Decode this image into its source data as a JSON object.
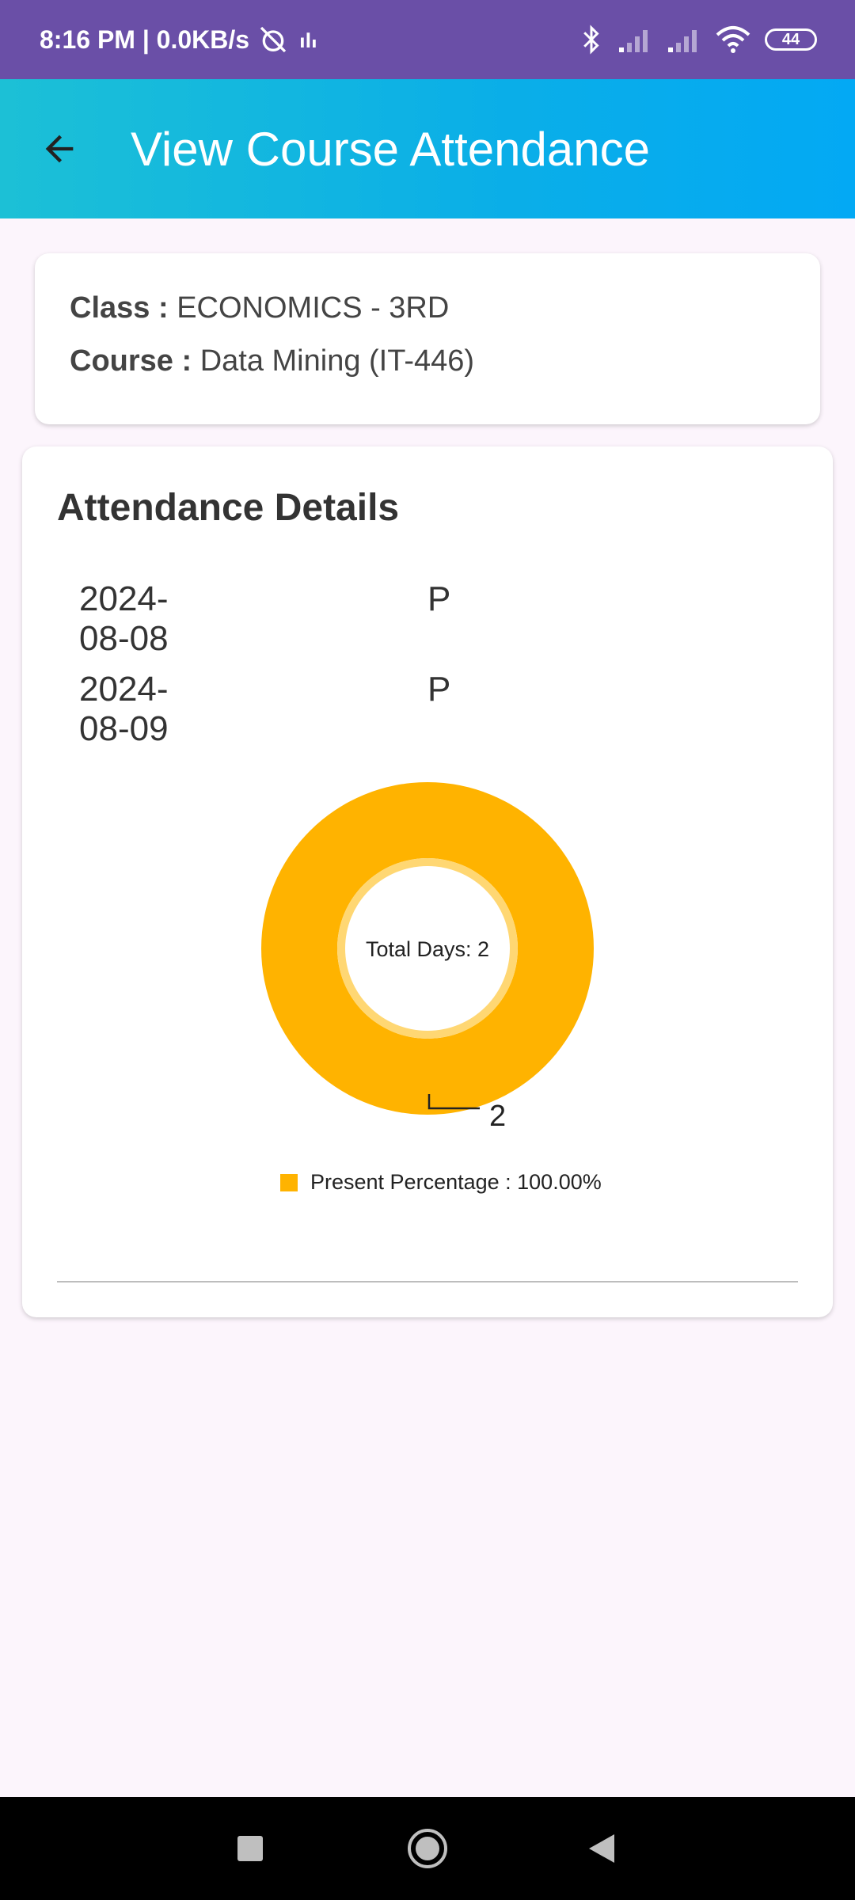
{
  "status_bar": {
    "time_text": "8:16 PM | 0.0KB/s",
    "battery": "44"
  },
  "app_bar": {
    "title": "View Course Attendance"
  },
  "info": {
    "class_label": "Class :",
    "class_value": "ECONOMICS - 3RD",
    "course_label": "Course :",
    "course_value": "Data Mining (IT-446)"
  },
  "attendance": {
    "heading": "Attendance Details",
    "rows": [
      {
        "date": "2024-08-08",
        "status": "P"
      },
      {
        "date": "2024-08-09",
        "status": "P"
      }
    ]
  },
  "chart_data": {
    "type": "pie",
    "center_text": "Total Days: 2",
    "slices": [
      {
        "label": "Present",
        "value": 2,
        "color": "#ffb300"
      }
    ],
    "slice_label": "2",
    "legend_entries": [
      {
        "text": "Present  Percentage : 100.00%",
        "color": "#ffb300"
      }
    ]
  },
  "colors": {
    "status_bar": "#6a4fa7",
    "app_bar_start": "#1cc0d6",
    "app_bar_end": "#03a9f4",
    "present": "#ffb300"
  }
}
